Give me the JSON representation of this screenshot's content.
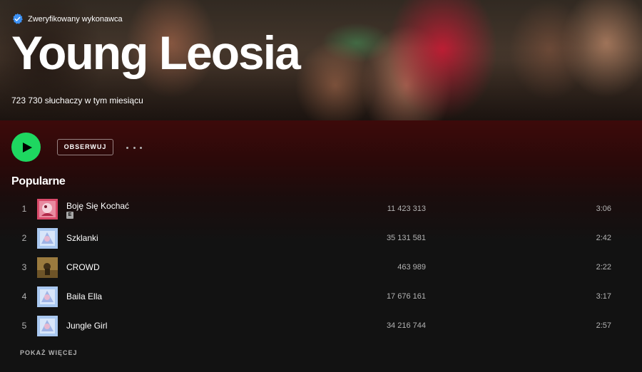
{
  "artist": {
    "verified_label": "Zweryfikowany wykonawca",
    "name": "Young Leosia",
    "monthly_listeners": "723 730 słuchaczy w tym miesiącu"
  },
  "controls": {
    "follow_label": "OBSERWUJ",
    "more_icon": "more-horizontal-icon",
    "play_icon": "play-icon"
  },
  "popular": {
    "title": "Popularne",
    "tracks": [
      {
        "num": "1",
        "title": "Boję Się Kochać",
        "explicit": "E",
        "plays": "11 423 313",
        "duration": "3:06"
      },
      {
        "num": "2",
        "title": "Szklanki",
        "plays": "35 131 581",
        "duration": "2:42"
      },
      {
        "num": "3",
        "title": "CROWD",
        "plays": "463 989",
        "duration": "2:22"
      },
      {
        "num": "4",
        "title": "Baila Ella",
        "plays": "17 676 161",
        "duration": "3:17"
      },
      {
        "num": "5",
        "title": "Jungle Girl",
        "plays": "34 216 744",
        "duration": "2:57"
      }
    ],
    "show_more": "POKAŻ WIĘCEJ"
  },
  "colors": {
    "accent": "#1ed760",
    "verified": "#3d91f4",
    "background": "#121212",
    "gradient_top": "#3d0a0a"
  }
}
